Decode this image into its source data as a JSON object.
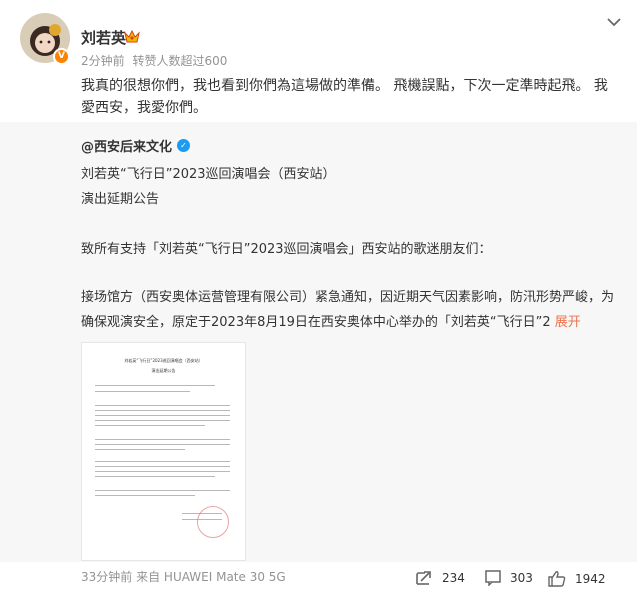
{
  "post": {
    "author": "刘若英",
    "time": "2分钟前",
    "reposts_note": "转赞人数超过600",
    "text": "我真的很想你們，我也看到你們為這場做的準備。 飛機誤點，下次一定準時起飛。 我愛西安，我愛你們。"
  },
  "repost": {
    "author": "@西安后来文化",
    "line1": "刘若英“飞行日”2023巡回演唱会（西安站）",
    "line2": "演出延期公告",
    "line3": "致所有支持「刘若英“飞行日”2023巡回演唱会」西安站的歌迷朋友们：",
    "para": "接场馆方（西安奥体运营管理有限公司）紧急通知，因近期天气因素影响，防汛形势严峻，为确保观演安全，原定于2023年8月19日在西安奥体中心举办的「刘若英“飞行日”2",
    "expand_label": "展开",
    "image_title": "刘若英“飞行日”2023巡回演唱会（西安站）",
    "image_subtitle": "演出延期公告"
  },
  "footer": {
    "time": "33分钟前",
    "source": "来自 HUAWEI Mate 30 5G",
    "repost_count": "234",
    "comment_count": "303",
    "like_count": "1942"
  },
  "icons": {
    "repost": "repost-icon",
    "comment": "comment-icon",
    "like": "like-icon",
    "chevron": "chevron-down-icon",
    "verified": "verified-badge-icon",
    "crown": "crown-icon"
  },
  "colors": {
    "accent": "#eb7350",
    "meta": "#939393",
    "repost_bg": "#f7f7f7",
    "verified_orange": "#ff8200",
    "verified_blue": "#1d9bf0"
  }
}
